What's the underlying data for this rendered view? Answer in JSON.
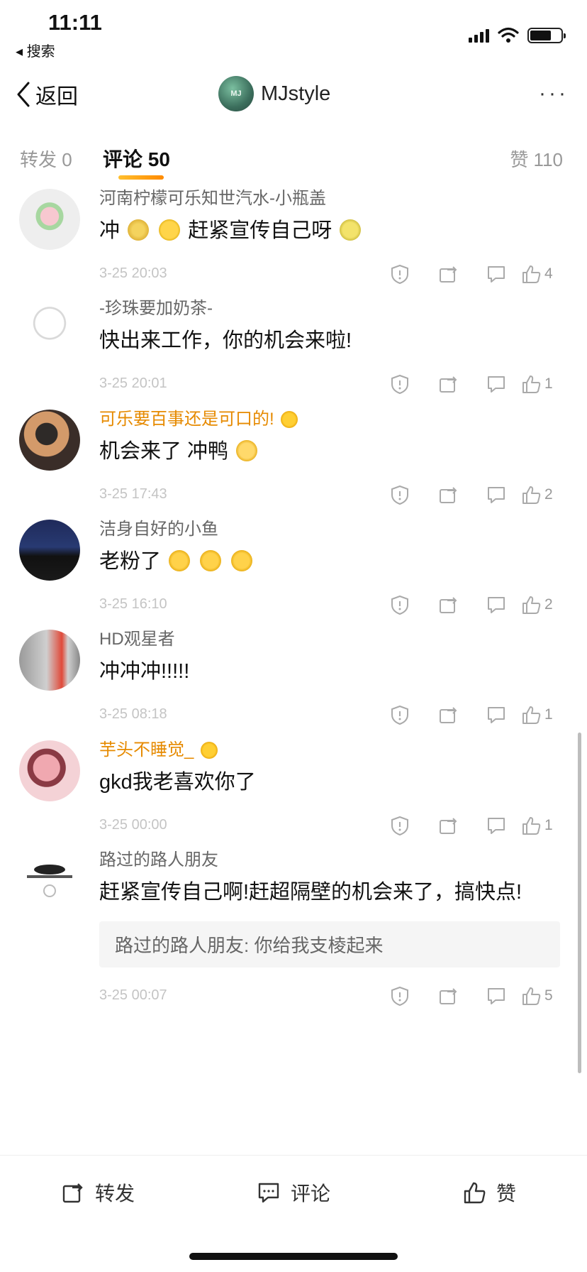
{
  "status": {
    "time": "11:11",
    "back_app": "◂ 搜索"
  },
  "nav": {
    "back_label": "返回",
    "title": "MJstyle",
    "more": "···"
  },
  "tabs": {
    "repost": "转发 0",
    "comment": "评论 50",
    "like": "赞 110"
  },
  "comments": [
    {
      "name": "河南柠檬可乐知世汽水-小瓶盖",
      "name_color": "gray",
      "text_before": "冲",
      "text_after": "赶紧宣传自己呀",
      "emojis_mid": [
        "thumbs",
        "grin"
      ],
      "emojis_end": [
        "cheer"
      ],
      "time": "3-25 20:03",
      "likes": "4"
    },
    {
      "name": "-珍珠要加奶茶-",
      "name_color": "gray",
      "text": "快出来工作，你的机会来啦!",
      "time": "3-25 20:01",
      "likes": "1"
    },
    {
      "name": "可乐要百事还是可口的!",
      "name_color": "gold",
      "text": "机会来了 冲鸭",
      "time": "3-25 17:43",
      "likes": "2"
    },
    {
      "name": "洁身自好的小鱼",
      "name_color": "gray",
      "text": "老粉了",
      "time": "3-25 16:10",
      "likes": "2"
    },
    {
      "name": "HD观星者",
      "name_color": "gray",
      "text": "冲冲冲!!!!!",
      "time": "3-25 08:18",
      "likes": "1"
    },
    {
      "name": "芋头不睡觉_",
      "name_color": "gold",
      "text": "gkd我老喜欢你了",
      "time": "3-25 00:00",
      "likes": "1"
    },
    {
      "name": "路过的路人朋友",
      "name_color": "gray",
      "text": "赶紧宣传自己啊!赶超隔壁的机会来了，搞快点!",
      "reply": "路过的路人朋友: 你给我支棱起来",
      "time": "3-25 00:07",
      "likes": "5"
    }
  ],
  "bottom_bar": {
    "repost": "转发",
    "comment": "评论",
    "like": "赞"
  },
  "colors": {
    "accent_gold": "#e68a00",
    "tab_underline_start": "#ffbf2e",
    "tab_underline_end": "#ff8a00"
  }
}
